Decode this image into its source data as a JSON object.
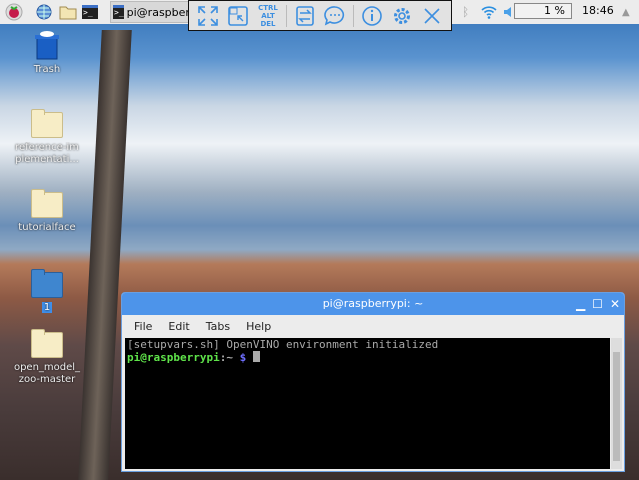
{
  "taskbar": {
    "task_label": "pi@raspberrypi: ~",
    "cpu": "1 %",
    "clock": "18:46"
  },
  "vnc_toolbar": {
    "ctrl_alt_del": "CTRL ALT DEL"
  },
  "desktop": {
    "icons": [
      {
        "label": "Trash"
      },
      {
        "label": "reference-implementati..."
      },
      {
        "label": "tutorialface"
      },
      {
        "label": "1"
      },
      {
        "label": "open_model_zoo-master"
      }
    ]
  },
  "terminal": {
    "title": "pi@raspberrypi: ~",
    "menu": [
      "File",
      "Edit",
      "Tabs",
      "Help"
    ],
    "line1": "[setupvars.sh] OpenVINO environment initialized",
    "prompt_user": "pi@raspberrypi",
    "prompt_path": ":~ ",
    "prompt_sym": "$"
  },
  "colors": {
    "accent": "#4d94ea",
    "prompt_green": "#5fe34a",
    "prompt_blue": "#6f6fff"
  }
}
